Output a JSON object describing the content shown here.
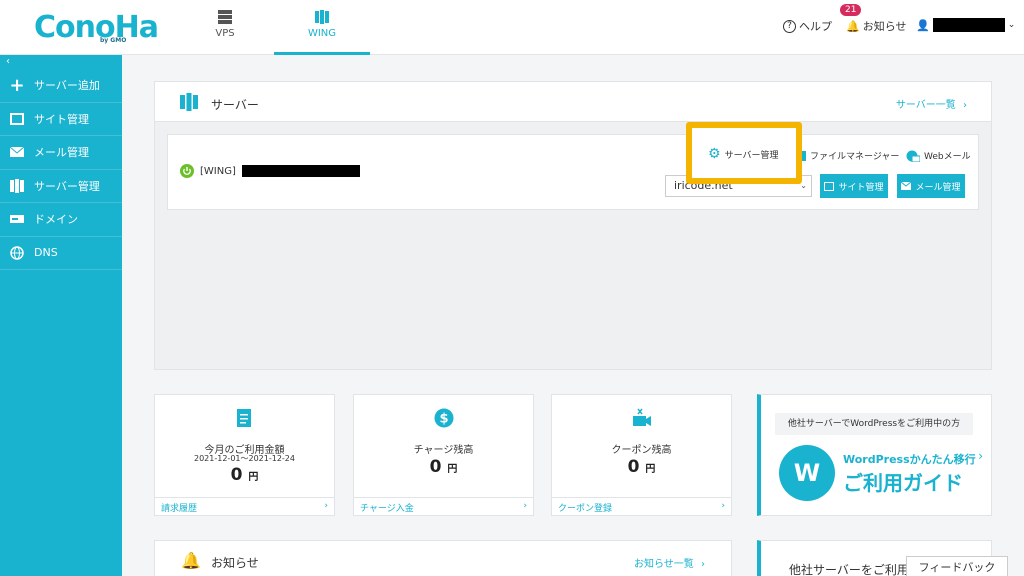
{
  "header": {
    "logo": "ConoHa",
    "logo_sub": "by GMO",
    "tabs": [
      {
        "label": "VPS"
      },
      {
        "label": "WING"
      }
    ],
    "help": "ヘルプ",
    "notifications": "お知らせ",
    "notification_count": "21"
  },
  "sidebar": {
    "collapse": "‹",
    "items": [
      {
        "label": "サーバー追加"
      },
      {
        "label": "サイト管理"
      },
      {
        "label": "メール管理"
      },
      {
        "label": "サーバー管理"
      },
      {
        "label": "ドメイン"
      },
      {
        "label": "DNS"
      }
    ]
  },
  "server_panel": {
    "title": "サーバー",
    "list_link": "サーバー一覧",
    "row_prefix": "[WING]",
    "server_manage": "サーバー管理",
    "file_manager": "ファイルマネージャー",
    "webmail": "Webメール",
    "domain": "iricode.net",
    "site_manage": "サイト管理",
    "mail_manage": "メール管理"
  },
  "cards": [
    {
      "title": "今月のご利用金額",
      "sub": "2021-12-01〜2021-12-24",
      "amount": "0",
      "unit": "円",
      "link": "請求履歴"
    },
    {
      "title": "チャージ残高",
      "amount": "0",
      "unit": "円",
      "link": "チャージ入金"
    },
    {
      "title": "クーポン残高",
      "amount": "0",
      "unit": "円",
      "link": "クーポン登録"
    }
  ],
  "ad": {
    "top": "他社サーバーでWordPressをご利用中の方",
    "line1": "WordPressかんたん移行",
    "line2": "ご利用ガイド"
  },
  "notice": {
    "title": "お知らせ",
    "link": "お知らせ一覧"
  },
  "ad2": {
    "title": "他社サーバーをご利用"
  },
  "feedback": "フィードバック",
  "colors": {
    "accent": "#19b2cf",
    "highlight": "#f5b400",
    "badge": "#d62b5f"
  }
}
